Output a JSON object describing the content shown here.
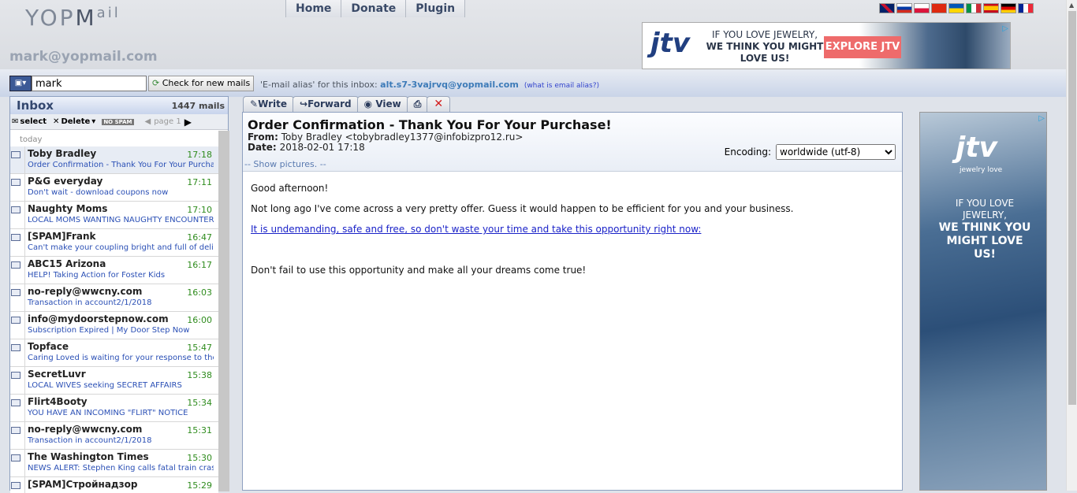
{
  "header": {
    "logo_pre": "YOP",
    "logo_m": "M",
    "logo_post": "ail",
    "current_email": "mark@yopmail.com",
    "nav": [
      "Home",
      "Donate",
      "Plugin"
    ]
  },
  "flags": [
    "#012169",
    "#ffffff",
    "#ffffff",
    "#de2910",
    "#0057b7",
    "#009246",
    "#c60b1e",
    "#000000",
    "#002395"
  ],
  "top_ad": {
    "logo": "jtv",
    "tagline_1": "IF YOU LOVE JEWELRY,",
    "tagline_2": "WE THINK YOU MIGHT",
    "tagline_3": "LOVE US!",
    "button": "EXPLORE JTV"
  },
  "login": {
    "value": "mark",
    "check_label": "Check for new mails"
  },
  "alias": {
    "label": "'E-mail alias' for this inbox:",
    "value": "alt.s7-3vajrvq@yopmail.com",
    "link": "(what is email alias?)"
  },
  "inbox": {
    "title": "Inbox",
    "count": "1447 mails",
    "select_label": "select",
    "delete_label": "Delete",
    "spam_label": "NO SPAM",
    "page_label": "page 1",
    "group": "today",
    "rows": [
      {
        "sender": "Toby Bradley",
        "time": "17:18",
        "subject": "Order Confirmation - Thank You For Your Purchase!"
      },
      {
        "sender": "P&G everyday",
        "time": "17:11",
        "subject": "Don't wait - download coupons now"
      },
      {
        "sender": "Naughty Moms",
        "time": "17:10",
        "subject": "LOCAL MOMS WANTING NAUGHTY ENCOUNTERS"
      },
      {
        "sender": "[SPAM]Frank",
        "time": "16:47",
        "subject": "Can't make your coupling bright and full of delight!"
      },
      {
        "sender": "ABC15 Arizona",
        "time": "16:17",
        "subject": "HELP! Taking Action for Foster Kids"
      },
      {
        "sender": "no-reply@wwcny.com",
        "time": "16:03",
        "subject": "Transaction in account2/1/2018"
      },
      {
        "sender": "info@mydoorstepnow.com",
        "time": "16:00",
        "subject": "Subscription Expired | My Door Step Now"
      },
      {
        "sender": "Topface",
        "time": "15:47",
        "subject": "Caring Loved is waiting for your response to their ..."
      },
      {
        "sender": "SecretLuvr",
        "time": "15:38",
        "subject": "LOCAL WIVES seeking SECRET AFFAIRS"
      },
      {
        "sender": "Flirt4Booty",
        "time": "15:34",
        "subject": "YOU HAVE AN INCOMING \"FLIRT\" NOTICE"
      },
      {
        "sender": "no-reply@wwcny.com",
        "time": "15:31",
        "subject": "Transaction in account2/1/2018"
      },
      {
        "sender": "The Washington Times",
        "time": "15:30",
        "subject": "NEWS ALERT: Stephen King calls fatal train crash '..."
      },
      {
        "sender": "[SPAM]Стройнадзор",
        "time": "15:29",
        "subject": ""
      }
    ]
  },
  "mail_tabs": {
    "write": "Write",
    "forward": "Forward",
    "view": "View"
  },
  "message": {
    "subject": "Order Confirmation - Thank You For Your Purchase!",
    "from_label": "From:",
    "from": "Toby Bradley <tobybradley1377@infobizpro12.ru>",
    "date_label": "Date:",
    "date": "2018-02-01 17:18",
    "show_pictures": "-- Show pictures. --",
    "encoding_label": "Encoding:",
    "encoding_value": "worldwide (utf-8)",
    "body_1": "Good afternoon!",
    "body_2": "Not long ago I've come across a very pretty offer. Guess it would happen to be efficient for you and your business.",
    "body_link": "It is undemanding, safe and free, so don't waste your time and take this opportunity right now:",
    "body_3": "Don't fail to use this opportunity and make all your dreams come true!"
  },
  "right_ad": {
    "logo": "jtv",
    "sub": "jewelry love",
    "line_1": "IF YOU LOVE JEWELRY,",
    "line_2": "WE THINK YOU MIGHT LOVE US!"
  }
}
